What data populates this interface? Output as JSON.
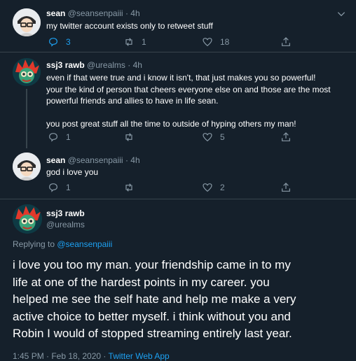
{
  "tweets": [
    {
      "name": "sean",
      "handle": "@seansenpaiii",
      "time": "· 4h",
      "text": "my twitter account exists only to retweet stuff",
      "replies": "3",
      "retweets": "1",
      "likes": "18"
    },
    {
      "name": "ssj3 rawb",
      "handle": "@urealms",
      "time": "· 4h",
      "text_lines": [
        "even if that were true and i know it isn't, that just makes you so powerful!",
        "your the kind of person that cheers everyone else on and those are the most",
        "powerful friends and allies to have in life sean."
      ],
      "text2": "you post great stuff all the time to outside of hyping others my man!",
      "replies": "1",
      "retweets": "",
      "likes": "5"
    },
    {
      "name": "sean",
      "handle": "@seansenpaiii",
      "time": "· 4h",
      "text": "god i love you",
      "replies": "1",
      "retweets": "",
      "likes": "2"
    }
  ],
  "main": {
    "name": "ssj3 rawb",
    "handle": "@urealms",
    "replying_prefix": "Replying to ",
    "replying_to": "@seansenpaiii",
    "text_lines": [
      "i love you too my man. your friendship came in to my",
      "life at one of the hardest points in my career. you",
      "helped me see the self hate and help me make a very",
      "active choice to better myself. i think without you and",
      "Robin I would of stopped streaming entirely last year."
    ],
    "footer_time": "1:45 PM · Feb 18, 2020 · ",
    "footer_app": "Twitter Web App"
  },
  "colors": {
    "background": "#15202b",
    "accent": "#1da1f2",
    "muted": "#8899a6",
    "divider": "#38444d"
  }
}
